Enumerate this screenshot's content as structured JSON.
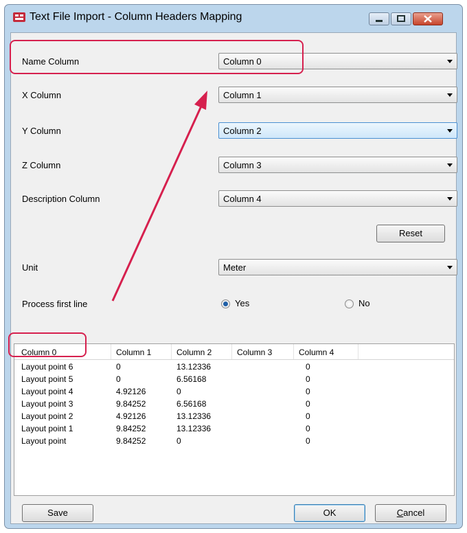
{
  "window": {
    "title": "Text File Import - Column Headers Mapping"
  },
  "fields": [
    {
      "label": "Name Column",
      "value": "Column 0"
    },
    {
      "label": "X Column",
      "value": "Column 1"
    },
    {
      "label": "Y Column",
      "value": "Column 2"
    },
    {
      "label": "Z Column",
      "value": "Column 3"
    },
    {
      "label": "Description Column",
      "value": "Column 4"
    }
  ],
  "reset_label": "Reset",
  "unit": {
    "label": "Unit",
    "value": "Meter"
  },
  "process_first_line": {
    "label": "Process first line",
    "options": [
      "Yes",
      "No"
    ],
    "selected": "Yes"
  },
  "table": {
    "columns": [
      "Column 0",
      "Column 1",
      "Column 2",
      "Column 3",
      "Column 4"
    ],
    "rows": [
      [
        "Layout point 6",
        "0",
        "13.12336",
        "",
        "0"
      ],
      [
        "Layout point 5",
        "0",
        "6.56168",
        "",
        "0"
      ],
      [
        "Layout point 4",
        "4.92126",
        "0",
        "",
        "0"
      ],
      [
        "Layout point 3",
        "9.84252",
        "6.56168",
        "",
        "0"
      ],
      [
        "Layout point 2",
        "4.92126",
        "13.12336",
        "",
        "0"
      ],
      [
        "Layout point 1",
        "9.84252",
        "13.12336",
        "",
        "0"
      ],
      [
        "Layout point",
        "9.84252",
        "0",
        "",
        "0"
      ]
    ]
  },
  "buttons": {
    "save": "Save",
    "ok": "OK",
    "cancel_first": "C",
    "cancel_rest": "ancel"
  },
  "annotation_color": "#d6204e",
  "icons": [
    "app-icon",
    "minimize-icon",
    "maximize-icon",
    "close-icon",
    "dropdown-arrow-icon"
  ]
}
